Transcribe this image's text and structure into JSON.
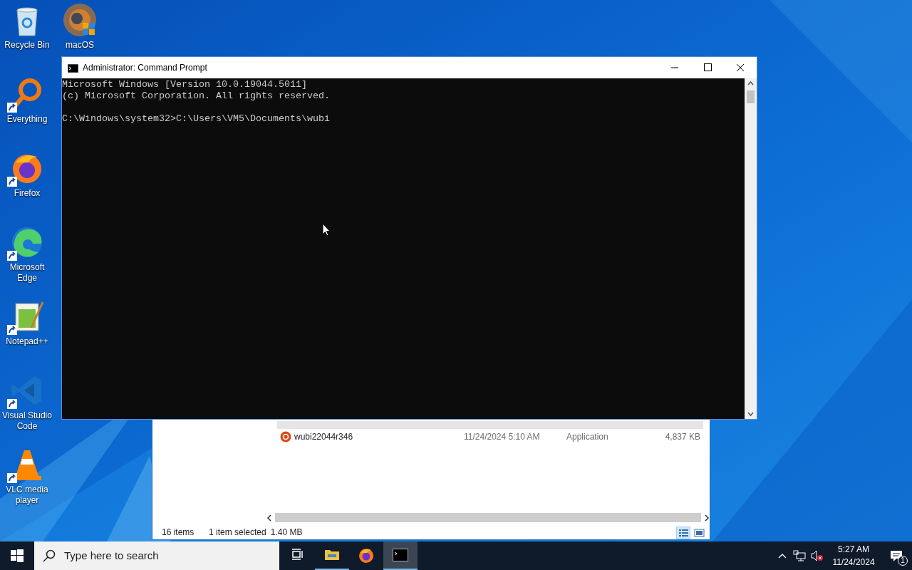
{
  "desktop_icons": [
    {
      "label": "Recycle Bin",
      "kind": "recycle",
      "shortcut": false
    },
    {
      "label": "Everything",
      "kind": "everything",
      "shortcut": true
    },
    {
      "label": "Firefox",
      "kind": "firefox",
      "shortcut": true
    },
    {
      "label": "Microsoft Edge",
      "kind": "edge",
      "shortcut": true
    },
    {
      "label": "Notepad++",
      "kind": "notepad",
      "shortcut": true
    },
    {
      "label": "Visual Studio Code",
      "kind": "vscode",
      "shortcut": true
    },
    {
      "label": "VLC media player",
      "kind": "vlc",
      "shortcut": true
    }
  ],
  "desktop_icon_second_column": [
    {
      "label": "macOS",
      "kind": "macos",
      "shortcut": false
    }
  ],
  "explorer": {
    "rows": [
      {
        "selected": true
      },
      {
        "name": "wubi22044r346",
        "date": "11/24/2024 5:10 AM",
        "type": "Application",
        "size": "4,837 KB",
        "kind": "ubuntu",
        "selected": false
      }
    ],
    "status": {
      "count": "16 items",
      "selection": "1 item selected",
      "size": "1.40 MB"
    },
    "views": [
      {
        "kind": "details",
        "selected": true
      },
      {
        "kind": "large",
        "selected": false
      }
    ]
  },
  "console": {
    "title": "Administrator: Command Prompt",
    "blocks": [
      [
        "Microsoft Windows [Version 10.0.19044.5011]",
        "(c) Microsoft Corporation. All rights reserved."
      ],
      [
        "C:\\Windows\\system32>C:\\Users\\VM5\\Documents\\wubi"
      ]
    ]
  },
  "taskbar": {
    "search": {
      "placeholder": "Type here to search"
    },
    "apps": [
      {
        "kind": "taskview",
        "running": false,
        "active": false
      },
      {
        "kind": "explorer",
        "running": true,
        "active": false
      },
      {
        "kind": "firefox",
        "running": false,
        "active": false
      },
      {
        "kind": "cmd",
        "running": true,
        "active": true
      }
    ],
    "tray": {
      "volume_muted": true,
      "time": "5:27 AM",
      "date": "11/24/2024",
      "notifications": "1"
    }
  }
}
